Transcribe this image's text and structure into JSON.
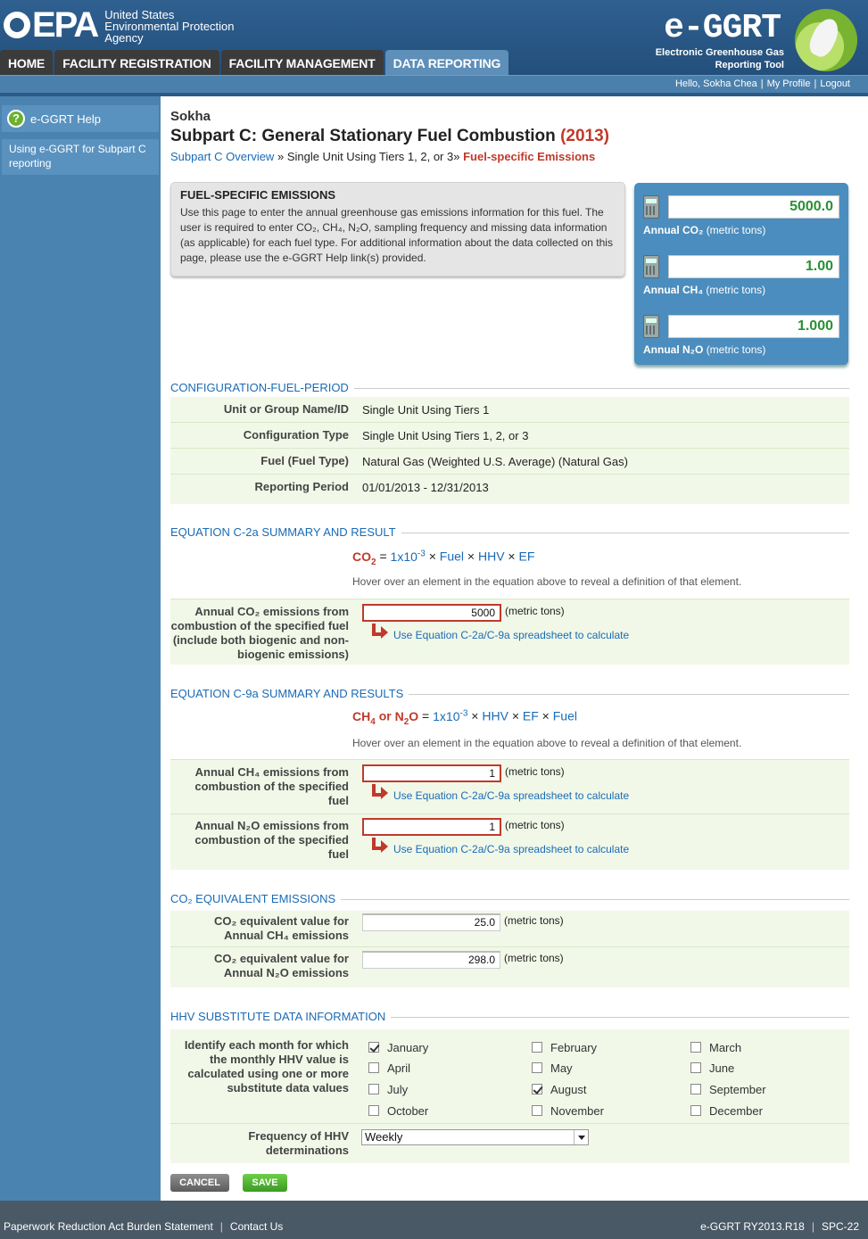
{
  "header": {
    "agency_line1": "United States",
    "agency_line2": "Environmental Protection",
    "agency_line3": "Agency",
    "logo_text": "EPA",
    "app_logo_text": "e-GGRT",
    "app_sub_line1": "Electronic Greenhouse Gas",
    "app_sub_line2": "Reporting Tool",
    "tabs": [
      {
        "label": "HOME"
      },
      {
        "label": "FACILITY REGISTRATION"
      },
      {
        "label": "FACILITY MANAGEMENT"
      },
      {
        "label": "DATA REPORTING"
      }
    ],
    "user_greeting": "Hello, Sokha Chea",
    "my_profile": "My Profile",
    "logout": "Logout"
  },
  "sidebar": {
    "help_label": "e-GGRT Help",
    "link_label": "Using e-GGRT for Subpart C reporting"
  },
  "main": {
    "facility_name": "Sokha",
    "page_title": "Subpart C: General Stationary Fuel Combustion",
    "page_year": "(2013)",
    "breadcrumb": {
      "link1": "Subpart C Overview",
      "sep": "»",
      "item2": "Single Unit Using Tiers 1, 2, or 3",
      "current": "Fuel-specific Emissions"
    },
    "info": {
      "title": "FUEL-SPECIFIC EMISSIONS",
      "text": "Use this page to enter the annual greenhouse gas emissions information for this fuel. The user is required to enter CO₂, CH₄, N₂O, sampling frequency and missing data information (as applicable) for each fuel type. For additional information about the data collected on this page, please use the e-GGRT Help link(s) provided."
    },
    "totals": [
      {
        "value": "5000.0",
        "label_bold": "Annual CO₂",
        "label_unit": "(metric tons)"
      },
      {
        "value": "1.00",
        "label_bold": "Annual CH₄",
        "label_unit": "(metric tons)"
      },
      {
        "value": "1.000",
        "label_bold": "Annual N₂O",
        "label_unit": "(metric tons)"
      }
    ],
    "config": {
      "heading": "CONFIGURATION-FUEL-PERIOD",
      "rows": [
        {
          "label": "Unit or Group Name/ID",
          "value": "Single Unit Using Tiers 1"
        },
        {
          "label": "Configuration Type",
          "value": "Single Unit Using Tiers 1, 2, or 3"
        },
        {
          "label": "Fuel (Fuel Type)",
          "value": "Natural Gas (Weighted U.S. Average) (Natural Gas)"
        },
        {
          "label": "Reporting Period",
          "value": "01/01/2013 - 12/31/2013"
        }
      ]
    },
    "eq_c2a": {
      "heading": "EQUATION C-2a SUMMARY AND RESULT",
      "eq_lhs": "CO",
      "eq_lhs_sub": "2",
      "eq_eq": "=",
      "eq_coef": "1x10",
      "eq_exp": "-3",
      "eq_times": "×",
      "eq_t1": "Fuel",
      "eq_t2": "HHV",
      "eq_t3": "EF",
      "hint": "Hover over an element in the equation above to reveal a definition of that element.",
      "co2_label": "Annual CO₂ emissions from combustion of the specified fuel (include both biogenic and non-biogenic emissions)",
      "co2_value": "5000",
      "unit": "(metric tons)",
      "calc_link": "Use Equation C-2a/C-9a spreadsheet to calculate"
    },
    "eq_c9a": {
      "heading": "EQUATION C-9a SUMMARY AND RESULTS",
      "eq_lhs_a": "CH",
      "eq_lhs_a_sub": "4",
      "eq_or": "or",
      "eq_lhs_b": "N",
      "eq_lhs_b_sub": "2",
      "eq_lhs_b2": "O",
      "eq_eq": "=",
      "eq_coef": "1x10",
      "eq_exp": "-3",
      "eq_times": "×",
      "eq_t1": "HHV",
      "eq_t2": "EF",
      "eq_t3": "Fuel",
      "hint": "Hover over an element in the equation above to reveal a definition of that element.",
      "ch4_label": "Annual CH₄ emissions from combustion of the specified fuel",
      "ch4_value": "1",
      "n2o_label": "Annual N₂O emissions from combustion of the specified fuel",
      "n2o_value": "1",
      "unit": "(metric tons)",
      "calc_link": "Use Equation C-2a/C-9a spreadsheet to calculate"
    },
    "co2e": {
      "heading": "CO₂ EQUIVALENT EMISSIONS",
      "ch4_label": "CO₂ equivalent value for Annual CH₄ emissions",
      "ch4_value": "25.0",
      "n2o_label": "CO₂ equivalent value for Annual N₂O emissions",
      "n2o_value": "298.0",
      "unit": "(metric tons)"
    },
    "hhv": {
      "heading": "HHV SUBSTITUTE DATA INFORMATION",
      "months_label": "Identify each month for which the monthly HHV value is calculated using one or more substitute data values",
      "months": [
        {
          "label": "January",
          "checked": true
        },
        {
          "label": "February",
          "checked": false
        },
        {
          "label": "March",
          "checked": false
        },
        {
          "label": "April",
          "checked": false
        },
        {
          "label": "May",
          "checked": false
        },
        {
          "label": "June",
          "checked": false
        },
        {
          "label": "July",
          "checked": false
        },
        {
          "label": "August",
          "checked": true
        },
        {
          "label": "September",
          "checked": false
        },
        {
          "label": "October",
          "checked": false
        },
        {
          "label": "November",
          "checked": false
        },
        {
          "label": "December",
          "checked": false
        }
      ],
      "freq_label": "Frequency of HHV determinations",
      "freq_value": "Weekly"
    },
    "buttons": {
      "cancel": "CANCEL",
      "save": "SAVE"
    }
  },
  "footer": {
    "paperwork": "Paperwork Reduction Act Burden Statement",
    "contact": "Contact Us",
    "version": "e-GGRT RY2013.R18",
    "page_code": "SPC-22"
  },
  "colors": {
    "header_blue": "#2c5a86",
    "sidebar_blue": "#4a83b0",
    "link_blue": "#1a6bb5",
    "accent_red": "#c0392b",
    "total_green": "#2a9034",
    "row_green": "#f1f8e8"
  }
}
